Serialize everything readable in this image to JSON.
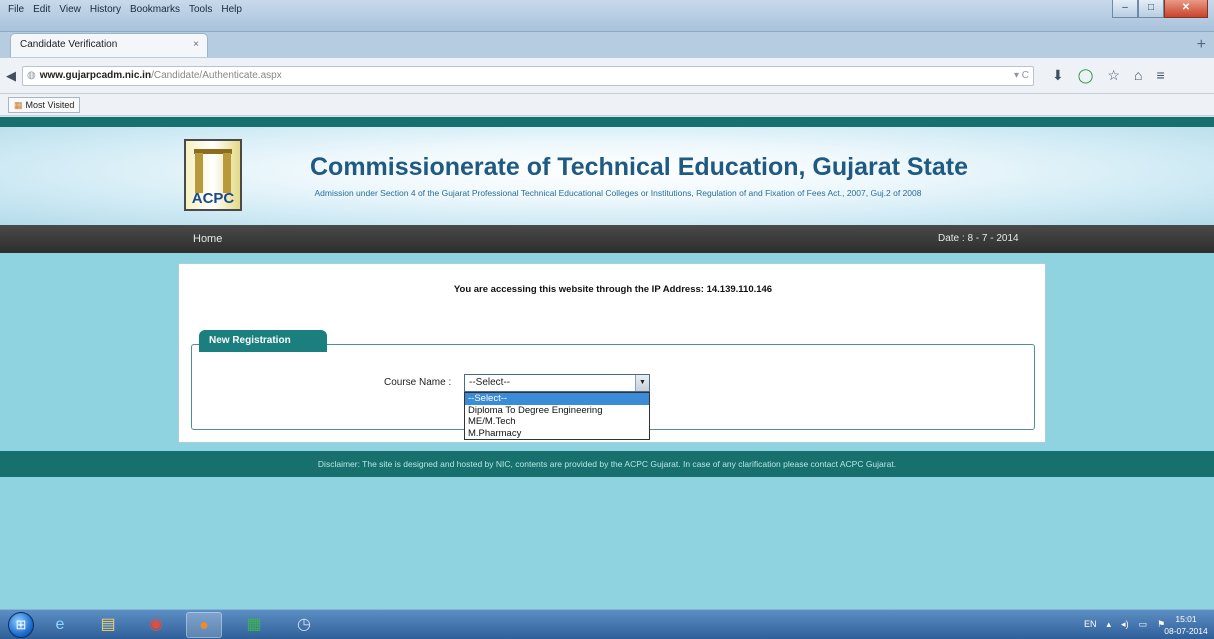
{
  "browser": {
    "menu": [
      "File",
      "Edit",
      "View",
      "History",
      "Bookmarks",
      "Tools",
      "Help"
    ],
    "tab_title": "Candidate Verification",
    "tab_close": "×",
    "new_tab": "+",
    "url_host": "www.gujarpcadm.nic.in",
    "url_path": "/Candidate/Authenticate.aspx",
    "url_reload": "▾ C",
    "bookmark": "Most Visited"
  },
  "site": {
    "logo_text": "ACPC",
    "title": "Commissionerate of Technical Education, Gujarat State",
    "subtitle": "Admission under Section 4 of the Gujarat Professional Technical Educational Colleges or Institutions, Regulation of and Fixation of Fees Act., 2007, Guj.2 of 2008",
    "nav_home": "Home",
    "date": "Date : 8 - 7 - 2014"
  },
  "main": {
    "ip_message": "You are accessing this website through the IP Address: 14.139.110.146",
    "panel_title": "New Registration",
    "course_label": "Course Name :",
    "selected_course": "--Select--",
    "course_options": [
      "--Select--",
      "Diploma To Degree Engineering",
      "ME/M.Tech",
      "M.Pharmacy"
    ]
  },
  "footer": {
    "disclaimer": "Disclaimer: The site is designed and hosted by NIC, contents are provided by the ACPC Gujarat. In case of any clarification please contact ACPC Gujarat."
  },
  "taskbar": {
    "language": "EN",
    "time": "15:01",
    "date": "08-07-2014"
  }
}
